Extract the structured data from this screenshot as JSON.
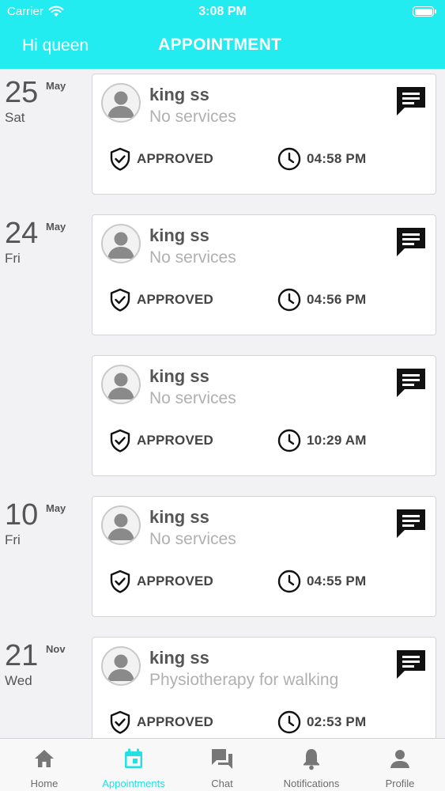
{
  "status_bar": {
    "carrier": "Carrier",
    "time": "3:08 PM"
  },
  "header": {
    "greeting": "Hi queen",
    "title": "APPOINTMENT"
  },
  "date_groups": [
    {
      "day": "25",
      "month": "May",
      "weekday": "Sat"
    },
    {
      "day": "24",
      "month": "May",
      "weekday": "Fri"
    },
    {
      "day": "10",
      "month": "May",
      "weekday": "Fri"
    },
    {
      "day": "21",
      "month": "Nov",
      "weekday": "Wed"
    }
  ],
  "appointments": [
    {
      "name": "king ss",
      "service": "No services",
      "status": "APPROVED",
      "time": "04:58 PM"
    },
    {
      "name": "king ss",
      "service": "No services",
      "status": "APPROVED",
      "time": "04:56 PM"
    },
    {
      "name": "king ss",
      "service": "No services",
      "status": "APPROVED",
      "time": "10:29 AM"
    },
    {
      "name": "king ss",
      "service": "No services",
      "status": "APPROVED",
      "time": "04:55 PM"
    },
    {
      "name": "king ss",
      "service": "Physiotherapy for walking",
      "status": "APPROVED",
      "time": "02:53 PM"
    }
  ],
  "tabs": [
    {
      "label": "Home",
      "icon": "home-icon"
    },
    {
      "label": "Appointments",
      "icon": "calendar-icon"
    },
    {
      "label": "Chat",
      "icon": "chat-icon"
    },
    {
      "label": "Notifications",
      "icon": "bell-icon"
    },
    {
      "label": "Profile",
      "icon": "person-icon"
    }
  ],
  "colors": {
    "accent": "#22ecf0",
    "active_tab": "#22e0e6",
    "inactive_tab": "#6d6d6d"
  }
}
